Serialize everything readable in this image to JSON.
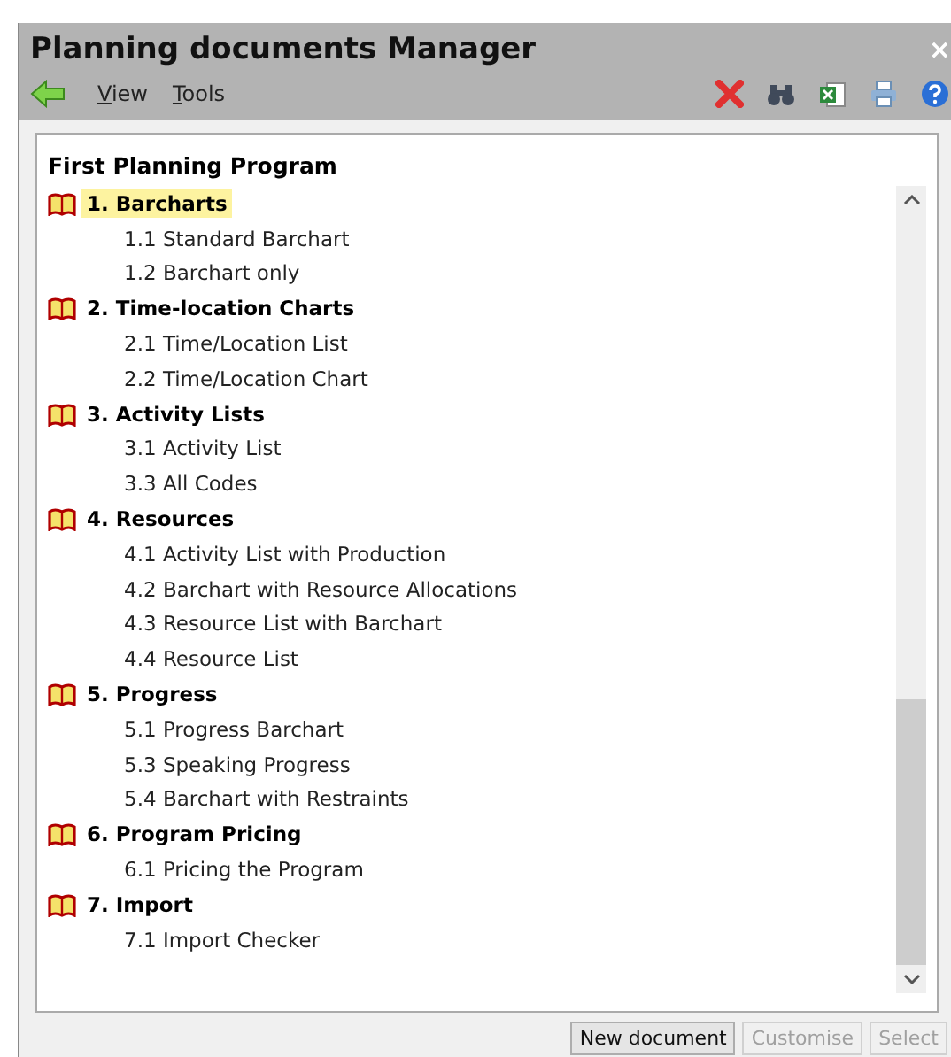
{
  "window": {
    "title": "Planning documents Manager",
    "close": "×"
  },
  "menu": [
    {
      "label": "View"
    },
    {
      "label": "Tools"
    }
  ],
  "toolbar": [
    {
      "kind": "delete"
    },
    {
      "kind": "find"
    },
    {
      "kind": "excel"
    },
    {
      "kind": "print"
    },
    {
      "kind": "help"
    }
  ],
  "program": {
    "title": "First Planning Program"
  },
  "tree": [
    {
      "label": "1. Barcharts",
      "selected": true,
      "children": [
        {
          "label": "1.1 Standard Barchart",
          "selected": false
        },
        {
          "label": "1.2 Barchart only",
          "selected": false
        }
      ]
    },
    {
      "label": "2. Time-location Charts",
      "selected": false,
      "children": [
        {
          "label": "2.1 Time/Location List",
          "selected": false
        },
        {
          "label": "2.2 Time/Location Chart",
          "selected": false
        }
      ]
    },
    {
      "label": "3. Activity Lists",
      "selected": false,
      "children": [
        {
          "label": "3.1 Activity List",
          "selected": false
        },
        {
          "label": "3.3 All Codes",
          "selected": false
        }
      ]
    },
    {
      "label": "4. Resources",
      "selected": false,
      "children": [
        {
          "label": "4.1 Activity List with Production",
          "selected": false
        },
        {
          "label": "4.2 Barchart with Resource Allocations",
          "selected": false
        },
        {
          "label": "4.3 Resource List with Barchart",
          "selected": false
        },
        {
          "label": "4.4 Resource List",
          "selected": false
        }
      ]
    },
    {
      "label": "5. Progress",
      "selected": false,
      "children": [
        {
          "label": "5.1 Progress Barchart",
          "selected": false
        },
        {
          "label": "5.3 Speaking Progress",
          "selected": false
        },
        {
          "label": "5.4 Barchart with Restraints",
          "selected": false
        }
      ]
    },
    {
      "label": "6. Program Pricing",
      "selected": false,
      "children": [
        {
          "label": "6.1 Pricing the Program",
          "selected": false
        }
      ]
    },
    {
      "label": "7. Import",
      "selected": false,
      "children": [
        {
          "label": "7.1 Import Checker",
          "selected": false
        }
      ]
    }
  ],
  "buttons": [
    {
      "label": "New document",
      "disabled": false
    },
    {
      "label": "Customise",
      "disabled": true
    },
    {
      "label": "Select",
      "disabled": true
    }
  ]
}
